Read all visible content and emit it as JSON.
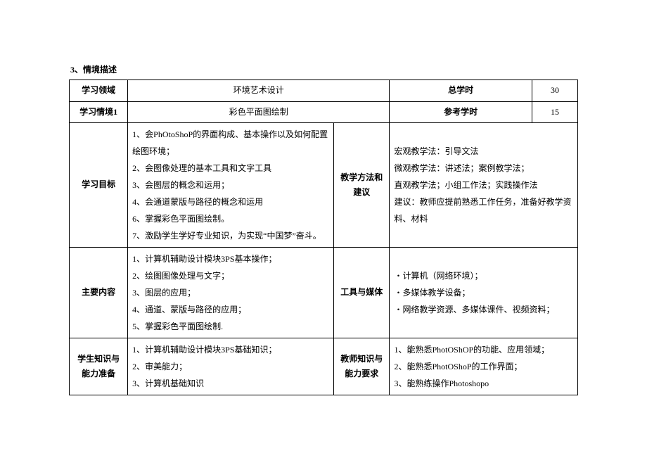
{
  "section_title": "3、情境描述",
  "header": {
    "row1": {
      "k1": "学习领域",
      "v1": "环境艺术设计",
      "k2": "总学时",
      "v2": "30"
    },
    "row2": {
      "k1": "学习情境1",
      "v1": "彩色平面图绘制",
      "k2": "参考学时",
      "v2": "15"
    }
  },
  "rows": [
    {
      "left_label": "学习目标",
      "left_items": [
        "1、会PhOtoShoP的界面构成、基本操作以及如何配置绘图环境；",
        "2、会图像处理的基本工具和文字工具",
        "3、会图层的概念和运用；",
        "4、会通道蒙版与路径的概念和运用",
        "6、掌握彩色平面图绘制。",
        "7、激励学生学好专业知识，为实现“中国梦”奋斗。"
      ],
      "mid_label": "教学方法和建议",
      "right_items": [
        "宏观教学法：引导文法",
        "微观教学法：讲述法；案例教学法；",
        "直观教学法；小组工作法；实践操作法",
        "建议：教师应提前熟悉工作任务，准备好教学资料、材料"
      ]
    },
    {
      "left_label": "主要内容",
      "left_items": [
        "1、计算机辅助设计模块3PS基本操作；",
        "2、绘图图像处理与文字；",
        "3、图层的应用；",
        "4、通道、蒙版与路径的应用；",
        "5、掌握彩色平面图绘制."
      ],
      "mid_label": "工具与媒体",
      "right_items": [
        "・计算机（网络环境）；",
        "・多媒体教学设备；",
        "・网络教学资源、多媒体课件、视频资料；"
      ]
    },
    {
      "left_label": "学生知识与能力准备",
      "left_items": [
        "1、计算机辅助设计模块3PS基础知识；",
        "2、审美能力；",
        "3、计算机基础知识"
      ],
      "mid_label": "教师知识与能力要求",
      "right_items": [
        "1、能熟悉PhotOShOP的功能、应用领域；",
        "2、能熟悉PhotOShoP的工作界面；",
        "3、能熟练操作Photoshopo"
      ]
    }
  ]
}
